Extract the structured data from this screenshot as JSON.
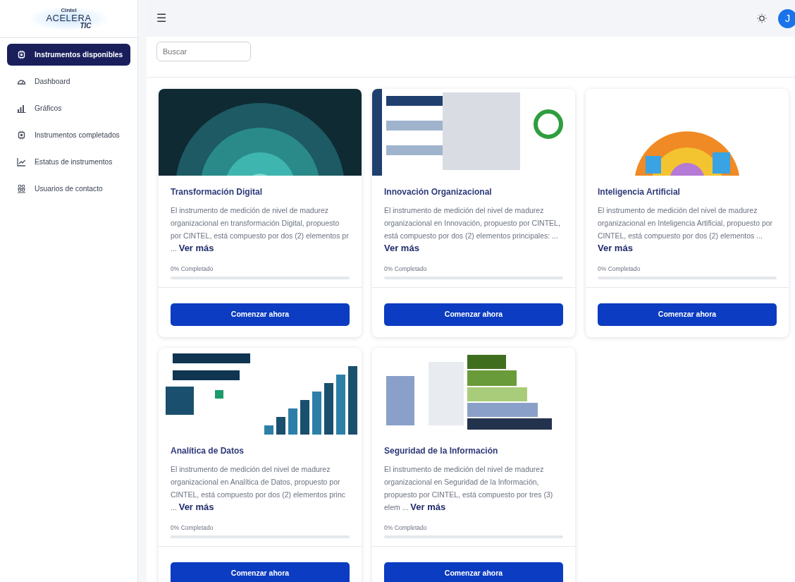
{
  "logo": {
    "small": "Cintel",
    "main": "ACELERA",
    "sub": "TIC"
  },
  "sidebar": {
    "items": [
      {
        "label": "Instrumentos disponibles",
        "selected": true
      },
      {
        "label": "Dashboard",
        "selected": false
      },
      {
        "label": "Gráficos",
        "selected": false
      },
      {
        "label": "Instrumentos completados",
        "selected": false
      },
      {
        "label": "Estatus de instrumentos",
        "selected": false
      },
      {
        "label": "Usuarios de contacto",
        "selected": false
      }
    ]
  },
  "topbar": {
    "menu_icon": "☰",
    "avatar": "J"
  },
  "search": {
    "placeholder": "Buscar"
  },
  "cards": [
    {
      "title": "Transformación Digital",
      "description": "El instrumento de medición de nivel de madurez organizacional en transformación Digital, propuesto por CINTEL, está compuesto por dos (2) elementos pr ...",
      "link": "Ver más",
      "progress_label": "0% Completado",
      "level": 0,
      "button": "Comenzar ahora"
    },
    {
      "title": "Innovación Organizacional",
      "description": "El instrumento de medición del nivel de madurez organizacional en Innovación, propuesto por CINTEL, está compuesto por dos (2) elementos principales: ...",
      "link": "Ver más",
      "progress_label": "0% Completado",
      "level": 0,
      "button": "Comenzar ahora"
    },
    {
      "title": "Inteligencia Artificial",
      "description": "El instrumento de medición del nivel de madurez organizacional en Inteligencia Artificial, propuesto por CINTEL, está compuesto por dos (2) elementos ...",
      "link": "Ver más",
      "progress_label": "0% Completado",
      "level": 0,
      "button": "Comenzar ahora"
    },
    {
      "title": "Analítica de Datos",
      "description": "El instrumento de medición del nivel de madurez organizacional en Analítica de Datos, propuesto por CINTEL, está compuesto por dos (2) elementos princ ...",
      "link": "Ver más",
      "progress_label": "0% Completado",
      "level": 0,
      "button": "Comenzar ahora"
    },
    {
      "title": "Seguridad de la Información",
      "description": "El instrumento de medición del nivel de madurez organizacional en  Seguridad de la Información, propuesto por CINTEL, está compuesto por tres (3) elem ...",
      "link": "Ver más",
      "progress_label": "0% Completado",
      "level": 0,
      "button": "Comenzar ahora"
    }
  ]
}
